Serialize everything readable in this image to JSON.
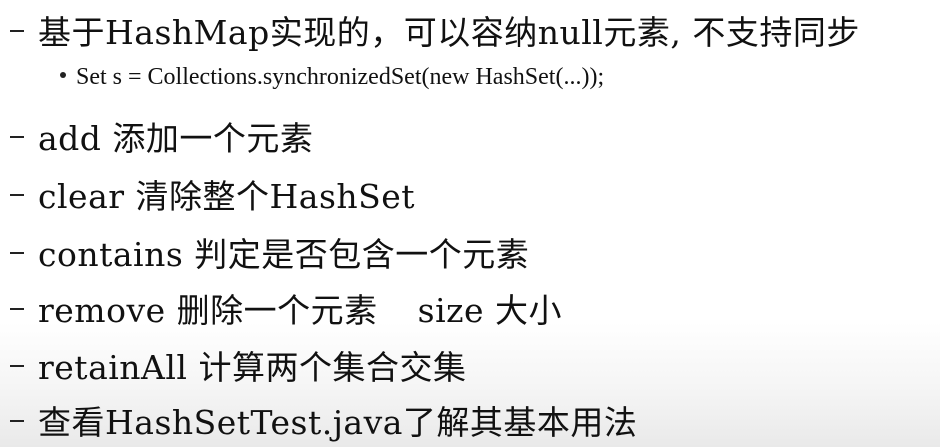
{
  "lines": [
    {
      "text": "基于HashMap实现的，可以容纳null元素, 不支持同步"
    },
    {
      "text": "Set s = Collections.synchronizedSet(new HashSet(...));"
    },
    {
      "text": "add  添加一个元素"
    },
    {
      "text": "clear 清除整个HashSet"
    },
    {
      "text": "contains 判定是否包含一个元素"
    },
    {
      "text": "remove 删除一个元素",
      "extra": "size 大小"
    },
    {
      "text": "retainAll 计算两个集合交集"
    },
    {
      "text": "查看HashSetTest.java了解其基本用法"
    }
  ]
}
